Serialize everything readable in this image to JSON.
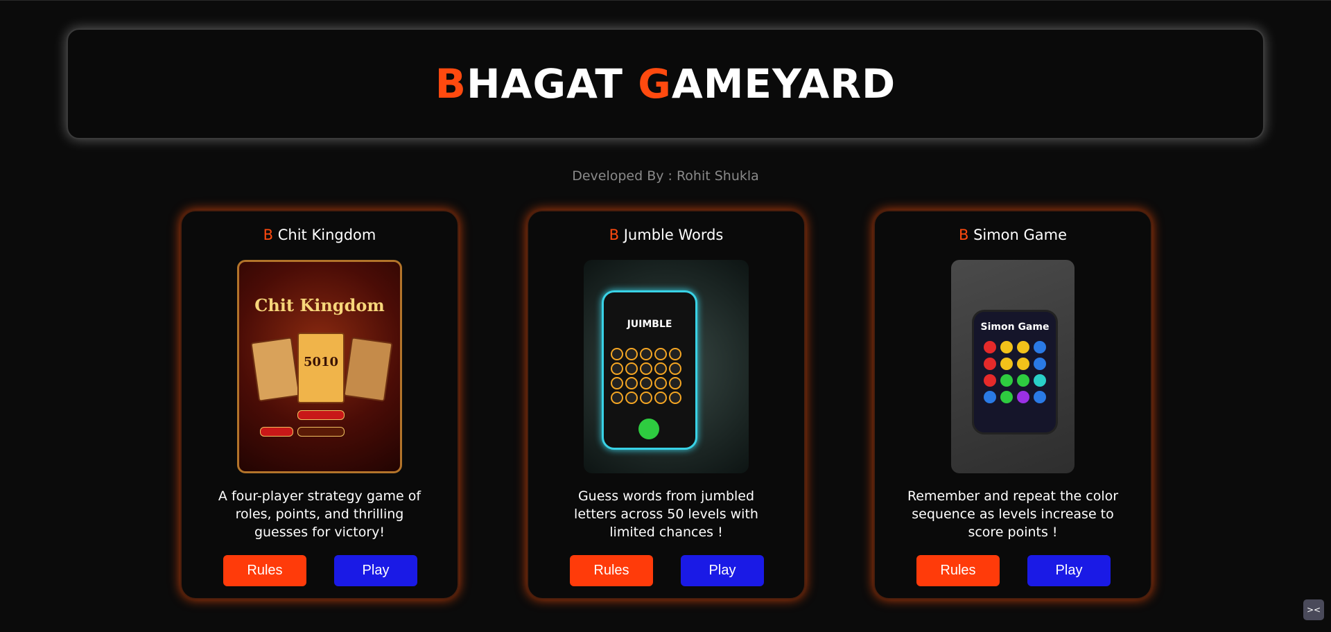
{
  "header": {
    "title_parts": [
      "B",
      "HAGAT ",
      "G",
      "AMEYARD"
    ],
    "accent_color": "#ff4a0f"
  },
  "credit": "Developed By : Rohit Shukla",
  "cards": [
    {
      "prefix": "B",
      "title": "Chit Kingdom",
      "description": "A four-player strategy game of roles, points, and thrilling guesses for victory!",
      "rules_label": "Rules",
      "play_label": "Play",
      "thumb_text": "Chit Kingdom",
      "thumb_value": "5010"
    },
    {
      "prefix": "B",
      "title": "Jumble Words",
      "description": "Guess words from jumbled letters across 50 levels with limited chances !",
      "rules_label": "Rules",
      "play_label": "Play",
      "thumb_text": "JUIMBLE"
    },
    {
      "prefix": "B",
      "title": "Simon Game",
      "description": "Remember and repeat the color sequence as levels increase to score points !",
      "rules_label": "Rules",
      "play_label": "Play",
      "thumb_text": "Simon Game"
    }
  ],
  "colors": {
    "rules_button": "#ff3b0a",
    "play_button": "#1a1ae6",
    "card_glow": "#ff500a"
  },
  "icons": {
    "corner_widget": "terminal-face-icon",
    "cursor": "mouse-pointer-icon"
  }
}
